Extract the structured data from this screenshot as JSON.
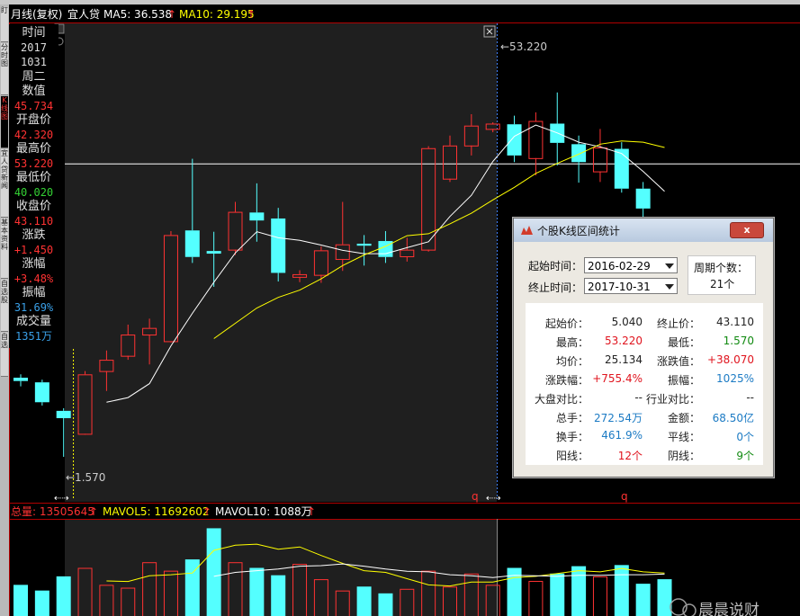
{
  "header": {
    "tab_label": "月线(复权)",
    "stock_name": "宜人贷",
    "ma5_label": "MA5: 36.538",
    "ma10_label": "MA10: 29.195",
    "arrow": "↑"
  },
  "left_tabs": [
    "盯",
    "分时图",
    "K线图",
    "宜人贷新闻",
    "基本资料",
    "自选股",
    "自选"
  ],
  "info_panel": {
    "time_label": "时间",
    "time_year": "2017",
    "time_md": "1031",
    "weekday": "周二",
    "value_label": "数值",
    "value": "45.734",
    "open_label": "开盘价",
    "open": "42.320",
    "high_label": "最高价",
    "high": "53.220",
    "low_label": "最低价",
    "low": "40.020",
    "close_label": "收盘价",
    "close": "43.110",
    "change_label": "涨跌",
    "change": "+1.450",
    "pct_label": "涨幅",
    "pct": "+3.48%",
    "amp_label": "振幅",
    "amp": "31.69%",
    "vol_label": "成交量",
    "vol": "1351万"
  },
  "annotations": {
    "high_price": "53.220",
    "low_price": "1.570",
    "marker_q": "q",
    "marker_arrows": "⇠⇢"
  },
  "volume_header": {
    "total_label": "总量: 13505645",
    "mavol5_label": "MAVOL5: 11692602",
    "mavol10_label": "MAVOL10: 1088万"
  },
  "watermark": "晨晨说财",
  "dialog": {
    "title": "个股K线区间统计",
    "close_label": "x",
    "start_time_label": "起始时间：",
    "start_time": "2016-02-29",
    "end_time_label": "终止时间：",
    "end_time": "2017-10-31",
    "period_count_label": "周期个数：",
    "period_count": "21个",
    "stats": [
      {
        "k": "起始价：",
        "v": "5.040",
        "k2": "终止价：",
        "v2": "43.110",
        "c": "#222",
        "c2": "#222"
      },
      {
        "k": "最高：",
        "v": "53.220",
        "k2": "最低：",
        "v2": "1.570",
        "c": "#e0141e",
        "c2": "#118a11"
      },
      {
        "k": "均价：",
        "v": "25.134",
        "k2": "涨跌值：",
        "v2": "+38.070",
        "c": "#222",
        "c2": "#e0141e"
      },
      {
        "k": "涨跌幅：",
        "v": "+755.4%",
        "k2": "振幅：",
        "v2": "1025%",
        "c": "#e0141e",
        "c2": "#1c7bc4"
      },
      {
        "k": "大盘对比：",
        "v": "--",
        "k2": "行业对比：",
        "v2": "--",
        "c": "#222",
        "c2": "#222"
      },
      {
        "k": "总手：",
        "v": "272.54万",
        "k2": "金额：",
        "v2": "68.50亿",
        "c": "#1c7bc4",
        "c2": "#1c7bc4"
      },
      {
        "k": "换手：",
        "v": "461.9%",
        "k2": "平线：",
        "v2": "0个",
        "c": "#1c7bc4",
        "c2": "#1c7bc4"
      },
      {
        "k": "阳线：",
        "v": "12个",
        "k2": "阴线：",
        "v2": "9个",
        "c": "#e0141e",
        "c2": "#118a11"
      }
    ]
  },
  "chart_data": {
    "type": "candlestick",
    "title": "",
    "price_range": [
      1.57,
      53.22
    ],
    "ohlc": [
      {
        "o": 13.5,
        "h": 14.0,
        "l": 12.2,
        "c": 13.0
      },
      {
        "o": 12.8,
        "h": 13.2,
        "l": 9.3,
        "c": 9.8
      },
      {
        "o": 8.5,
        "h": 8.9,
        "l": 1.57,
        "c": 7.4
      },
      {
        "o": 5.04,
        "h": 14.5,
        "l": 4.9,
        "c": 14.0
      },
      {
        "o": 14.5,
        "h": 17.6,
        "l": 11.5,
        "c": 16.2
      },
      {
        "o": 16.8,
        "h": 21.5,
        "l": 16.2,
        "c": 20.0
      },
      {
        "o": 20.0,
        "h": 22.4,
        "l": 15.5,
        "c": 21.0
      },
      {
        "o": 19.0,
        "h": 35.6,
        "l": 18.8,
        "c": 35.0
      },
      {
        "o": 35.7,
        "h": 46.5,
        "l": 30.8,
        "c": 31.7
      },
      {
        "o": 32.6,
        "h": 35.5,
        "l": 27.2,
        "c": 32.2
      },
      {
        "o": 32.8,
        "h": 40.0,
        "l": 32.0,
        "c": 38.5
      },
      {
        "o": 38.4,
        "h": 42.8,
        "l": 34.0,
        "c": 37.2
      },
      {
        "o": 37.5,
        "h": 39.1,
        "l": 28.0,
        "c": 29.3
      },
      {
        "o": 28.7,
        "h": 29.7,
        "l": 27.9,
        "c": 29.1
      },
      {
        "o": 29.0,
        "h": 33.3,
        "l": 27.8,
        "c": 32.7
      },
      {
        "o": 31.4,
        "h": 40.0,
        "l": 29.6,
        "c": 33.6
      },
      {
        "o": 33.7,
        "h": 35.0,
        "l": 30.4,
        "c": 33.4
      },
      {
        "o": 34.1,
        "h": 35.6,
        "l": 30.8,
        "c": 31.7
      },
      {
        "o": 31.8,
        "h": 34.6,
        "l": 31.0,
        "c": 32.8
      },
      {
        "o": 32.8,
        "h": 48.4,
        "l": 32.5,
        "c": 48.1
      },
      {
        "o": 43.5,
        "h": 50.0,
        "l": 43.0,
        "c": 48.5
      },
      {
        "o": 48.5,
        "h": 53.22,
        "l": 47.0,
        "c": 51.5
      },
      {
        "o": 51.0,
        "h": 52.0,
        "l": 50.5,
        "c": 51.8
      },
      {
        "o": 51.7,
        "h": 53.0,
        "l": 46.0,
        "c": 47.0
      },
      {
        "o": 46.6,
        "h": 53.5,
        "l": 44.0,
        "c": 52.2
      },
      {
        "o": 51.8,
        "h": 56.5,
        "l": 45.5,
        "c": 48.9
      },
      {
        "o": 48.7,
        "h": 50.0,
        "l": 42.9,
        "c": 46.0
      },
      {
        "o": 44.6,
        "h": 51.0,
        "l": 43.0,
        "c": 48.2
      },
      {
        "o": 48.0,
        "h": 49.0,
        "l": 41.4,
        "c": 42.0
      },
      {
        "o": 42.0,
        "h": 43.0,
        "l": 35.0,
        "c": 39.0
      },
      {
        "o": 34.0,
        "h": 36.0,
        "l": 32.0,
        "c": 33.8
      }
    ],
    "ma5": [
      null,
      null,
      null,
      null,
      9.8,
      10.5,
      12.6,
      18.3,
      23.2,
      27.9,
      32.3,
      35.5,
      34.6,
      34.2,
      33.5,
      32.7,
      32.2,
      32.2,
      33.1,
      34.0,
      37.8,
      41.0,
      46.1,
      49.9,
      51.6,
      50.4,
      49.0,
      48.3,
      47.3,
      44.6,
      41.6
    ],
    "ma10": [
      null,
      null,
      null,
      null,
      null,
      null,
      null,
      null,
      null,
      19.4,
      21.7,
      24.0,
      25.6,
      26.7,
      28.4,
      30.4,
      32.0,
      33.3,
      34.9,
      35.2,
      36.7,
      38.3,
      40.3,
      42.2,
      44.3,
      45.8,
      47.2,
      48.7,
      49.2,
      49.0,
      48.2
    ],
    "volume": [
      55,
      45,
      70,
      85,
      55,
      50,
      95,
      80,
      100,
      155,
      95,
      85,
      72,
      92,
      65,
      45,
      52,
      40,
      48,
      80,
      52,
      75,
      55,
      85,
      62,
      75,
      88,
      70,
      90,
      57,
      65
    ],
    "vol_range": [
      0,
      170
    ],
    "mavol5": [
      null,
      null,
      null,
      null,
      62,
      61,
      71,
      73,
      76,
      116,
      125,
      127,
      118,
      122,
      107,
      93,
      80,
      77,
      66,
      55,
      53,
      60,
      60,
      68,
      70,
      75,
      80,
      78,
      84,
      78,
      76
    ],
    "mavol10": [
      null,
      null,
      null,
      null,
      null,
      null,
      null,
      null,
      null,
      70,
      77,
      80,
      83,
      88,
      89,
      92,
      88,
      83,
      79,
      78,
      73,
      71,
      68,
      72,
      71,
      70,
      72,
      72,
      73,
      73,
      74
    ],
    "selection": {
      "start_index": 3,
      "end_index": 23
    },
    "crosshair_price": 45.734,
    "colors": {
      "up": "#ff3232",
      "down": "#54ffff",
      "ma5": "#ffffff",
      "ma10": "#ffff00"
    }
  }
}
